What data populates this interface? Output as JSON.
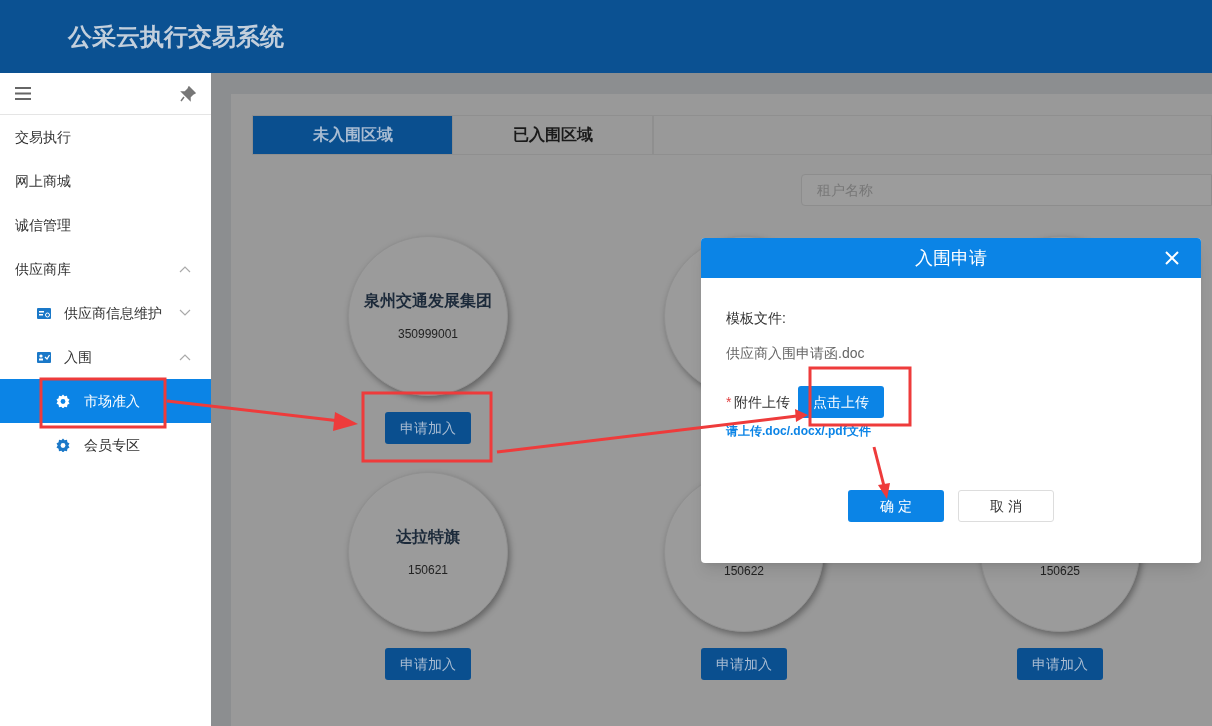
{
  "header": {
    "title": "公采云执行交易系统"
  },
  "sidebar": {
    "items": [
      {
        "label": "交易执行",
        "selected": false
      },
      {
        "label": "网上商城",
        "selected": false
      },
      {
        "label": "诚信管理",
        "selected": false
      },
      {
        "label": "供应商库",
        "expanded": true,
        "children": [
          {
            "label": "供应商信息维护",
            "expanded": false
          },
          {
            "label": "入围",
            "expanded": true,
            "children": [
              {
                "label": "市场准入",
                "selected": true
              },
              {
                "label": "会员专区",
                "selected": false
              }
            ]
          }
        ]
      }
    ]
  },
  "tabs": [
    {
      "label": "未入围区域",
      "selected": true
    },
    {
      "label": "已入围区域",
      "selected": false
    }
  ],
  "search": {
    "placeholder": "租户名称"
  },
  "cards": [
    {
      "kind": "shown",
      "name": "泉州交通发展集团",
      "code": "350999001",
      "button": "申请加入"
    },
    {
      "kind": "hidden"
    },
    {
      "kind": "hidden"
    },
    {
      "kind": "shown",
      "name": "达拉特旗",
      "code": "150621",
      "button": "申请加入"
    },
    {
      "kind": "shown",
      "code": "150622",
      "button": "申请加入"
    },
    {
      "kind": "shown",
      "code": "150625",
      "button": "申请加入"
    }
  ],
  "dialog": {
    "title": "入围申请",
    "template_label": "模板文件:",
    "template_file": "供应商入围申请函.doc",
    "upload_label": "附件上传",
    "required_mark": "*",
    "upload_button": "点击上传",
    "hint": "请上传.doc/.docx/.pdf文件",
    "buttons": [
      {
        "label": "确 定",
        "kind": "primary"
      },
      {
        "label": "取 消",
        "kind": "default"
      }
    ]
  }
}
